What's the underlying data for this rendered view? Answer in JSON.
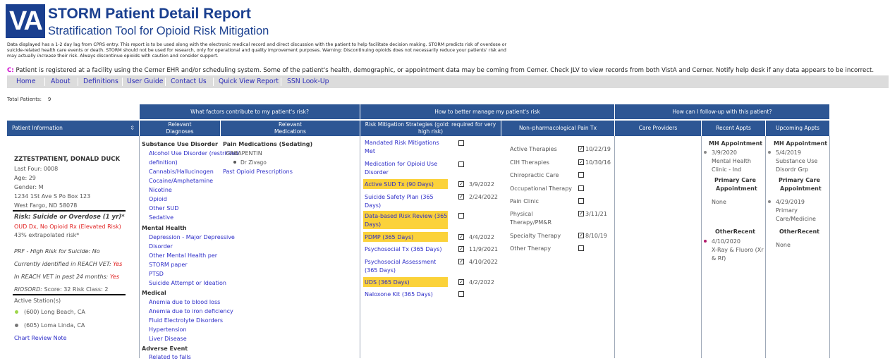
{
  "header": {
    "logo": "VA",
    "title": "STORM Patient Detail Report",
    "subtitle": "Stratification Tool for Opioid Risk Mitigation",
    "disclaimer_1": "Data displayed has a 1-2 day lag from CPRS entry. This report is to be used along with the electronic medical record and direct discussion with the patient to help facilitate decision making. STORM predicts risk of overdose or",
    "disclaimer_2": "suicide-related health care events or death. STORM should not be used for research, only for operational and quality improvement purposes. Warning: Discontinuing opioids does not necessarily reduce your patients' risk and",
    "disclaimer_3a": "may actually ",
    "disclaimer_3b": "increase",
    "disclaimer_3c": " their risk. Always discontinue opioids with caution and consider support.",
    "cerner_flag": "C:",
    "cerner_note": " Patient is registered at a facility using the Cerner EHR and/or scheduling system. Some of the patient's health, demographic, or appointment data may be coming from Cerner. Check JLV to view records from both VistA and Cerner. Notify help desk if any data appears to be incorrect."
  },
  "nav": [
    "Home",
    "About",
    "Definitions",
    "User Guide",
    "Contact Us",
    "Quick View Report",
    "SSN Look-Up"
  ],
  "total": {
    "label": "Total Patients:",
    "value": "9"
  },
  "groups": {
    "factors": "What factors contribute to my patient's risk?",
    "manage": "How to better manage my patient's risk",
    "followup": "How can I follow-up with this patient?"
  },
  "columns": {
    "patient_info": "Patient Information",
    "diagnoses_1": "Relevant",
    "diagnoses_2": "Diagnoses",
    "meds_1": "Relevant",
    "meds_2": "Medications",
    "strategies_1": "Risk Mitigation Strategies (gold: required for very",
    "strategies_2": "high risk)",
    "nonpharm": "Non–pharmacological Pain Tx",
    "providers": "Care Providers",
    "recent": "Recent Appts",
    "upcoming": "Upcoming Appts"
  },
  "patient": {
    "name": "ZZTESTPATIENT, DONALD DUCK",
    "last_four": "Last Four: 0008",
    "age": "Age: 29",
    "gender": "Gender: M",
    "address": "1234 1St Ave S Po Box 123",
    "city": "West Fargo, ND 58078",
    "risk_title": "Risk: Suicide or Overdose (1 yr)*",
    "risk_reason": "OUD Dx, No Opioid Rx (Elevated Risk)",
    "risk_pct": "43% extrapolated risk*",
    "prf_label": "PRF - High Risk for Suicide:",
    "prf_value": "No",
    "reach_label": "Currently identified in REACH VET:",
    "reach_value": "Yes",
    "reach24_label": "In REACH VET in past 24 months:",
    "reach24_value": "Yes",
    "riosord_label": "RIOSORD:",
    "riosord_value": "Score: 32 Risk Class: 2",
    "stations_label": "Active Station(s)",
    "station_1": "(600) Long Beach, CA",
    "station_2": "(605) Loma Linda, CA",
    "chart_note": "Chart Review Note"
  },
  "diagnoses": {
    "sud_head": "Substance Use Disorder",
    "sud": [
      "Alcohol Use Disorder (restricted",
      "definition)",
      "Cannabis/Hallucinogen",
      "Cocaine/Amphetamine",
      "Nicotine",
      "Opioid",
      "Other SUD",
      "Sedative"
    ],
    "mh_head": "Mental Health",
    "mh": [
      "Depression - Major Depressive",
      "Disorder",
      "Other Mental Health per",
      "STORM paper",
      "PTSD",
      "Suicide Attempt or Ideation"
    ],
    "med_head": "Medical",
    "med": [
      "Anemia due to blood loss",
      "Anemia due to iron deficiency",
      "Fluid Electrolyte Disorders",
      "Hypertension",
      "Liver Disease"
    ],
    "ae_head": "Adverse Event",
    "ae": [
      "Related to falls"
    ]
  },
  "medications": {
    "head": "Pain Medications (Sedating)",
    "drug": "GABAPENTIN",
    "prescriber": "Dr Zivago",
    "past_link": "Past Opioid Prescriptions"
  },
  "strategies": [
    {
      "l1": "Mandated Risk Mitigations",
      "l2": "Met",
      "checked": false,
      "date": "",
      "gold": false
    },
    {
      "l1": "Medication for Opioid Use",
      "l2": "Disorder",
      "checked": false,
      "date": "",
      "gold": false
    },
    {
      "l1": "Active SUD Tx (90 Days)",
      "l2": "",
      "checked": true,
      "date": "3/9/2022",
      "gold": true
    },
    {
      "l1": "Suicide Safety Plan (365",
      "l2": "Days)",
      "checked": true,
      "date": "2/24/2022",
      "gold": false
    },
    {
      "l1": "Data-based Risk Review (365",
      "l2": "Days)",
      "checked": false,
      "date": "",
      "gold": true
    },
    {
      "l1": "PDMP (365 Days)",
      "l2": "",
      "checked": true,
      "date": "4/4/2022",
      "gold": true
    },
    {
      "l1": "Psychosocial Tx (365 Days)",
      "l2": "",
      "checked": true,
      "date": "11/9/2021",
      "gold": false
    },
    {
      "l1": "Psychosocial Assessment",
      "l2": "(365 Days)",
      "checked": true,
      "date": "4/10/2022",
      "gold": false
    },
    {
      "l1": "UDS (365 Days)",
      "l2": "",
      "checked": true,
      "date": "4/2/2022",
      "gold": true
    },
    {
      "l1": "Naloxone Kit (365 Days)",
      "l2": "",
      "checked": false,
      "date": "",
      "gold": false
    }
  ],
  "nonpharm": [
    {
      "l1": "Active Therapies",
      "l2": "",
      "checked": true,
      "date": "10/22/19"
    },
    {
      "l1": "CIH Therapies",
      "l2": "",
      "checked": true,
      "date": "10/30/16"
    },
    {
      "l1": "Chiropractic Care",
      "l2": "",
      "checked": false,
      "date": ""
    },
    {
      "l1": "Occupational Therapy",
      "l2": "",
      "checked": false,
      "date": ""
    },
    {
      "l1": "Pain Clinic",
      "l2": "",
      "checked": false,
      "date": ""
    },
    {
      "l1": "Physical",
      "l2": "Therapy/PM&R",
      "checked": true,
      "date": "3/11/21"
    },
    {
      "l1": "Specialty Therapy",
      "l2": "",
      "checked": true,
      "date": "8/10/19"
    },
    {
      "l1": "Other Therapy",
      "l2": "",
      "checked": false,
      "date": ""
    }
  ],
  "recent": {
    "mh_head": "MH Appointment",
    "mh_date": "3/9/2020",
    "mh_l1": "Mental Health",
    "mh_l2": "Clinic - Ind",
    "pc_head_1": "Primary Care",
    "pc_head_2": "Appointment",
    "pc_none": "None",
    "other_head": "OtherRecent",
    "other_date": "4/10/2020",
    "other_l1": "X-Ray & Fluoro (Xr",
    "other_l2": "& Rf)"
  },
  "upcoming": {
    "mh_head": "MH Appointment",
    "mh_date": "5/4/2019",
    "mh_l1": "Substance Use",
    "mh_l2": "Disordr Grp",
    "pc_head_1": "Primary Care",
    "pc_head_2": "Appointment",
    "pc_date": "4/29/2019",
    "pc_l1": "Primary",
    "pc_l2": "Care/Medicine",
    "other_head": "OtherRecent",
    "other_none": "None"
  },
  "colors": {
    "brand": "#1a3f8f",
    "header_bg": "#2d5694",
    "gold": "#fbd23a",
    "alert": "#e02020",
    "link": "#2d2dc8"
  }
}
